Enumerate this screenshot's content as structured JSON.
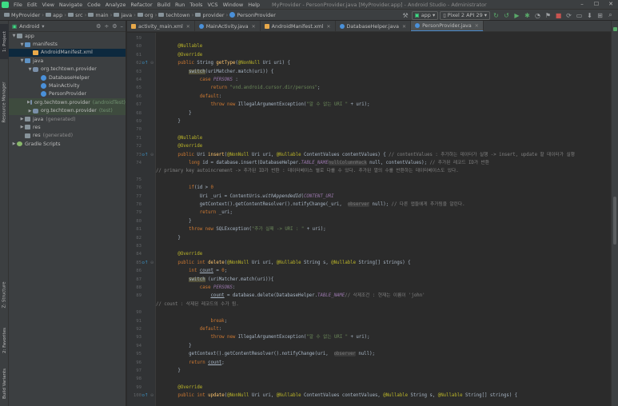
{
  "app": {
    "window_title": "MyProvider - PersonProvider.java [MyProvider.app] - Android Studio - Administrator"
  },
  "menu": [
    "File",
    "Edit",
    "View",
    "Navigate",
    "Code",
    "Analyze",
    "Refactor",
    "Build",
    "Run",
    "Tools",
    "VCS",
    "Window",
    "Help"
  ],
  "window_controls": [
    "–",
    "☐",
    "✕"
  ],
  "breadcrumb": [
    "MyProvider",
    "app",
    "src",
    "main",
    "java",
    "org",
    "techtown",
    "provider",
    "PersonProvider"
  ],
  "toolbar": {
    "run_config": "app",
    "device": "Pixel 2 API 29"
  },
  "left_tabs": [
    "1: Project",
    "Resource Manager",
    "Z: Structure",
    "2: Favorites",
    "Build Variants"
  ],
  "project": {
    "view_mode": "Android",
    "tree": [
      {
        "label": "app",
        "depth": 0,
        "icon": "folder",
        "expanded": true,
        "suffix": ""
      },
      {
        "label": "manifests",
        "depth": 1,
        "icon": "folder-blue",
        "expanded": true,
        "suffix": ""
      },
      {
        "label": "AndroidManifest.xml",
        "depth": 2,
        "icon": "xml",
        "expanded": null,
        "suffix": "",
        "selected": true
      },
      {
        "label": "java",
        "depth": 1,
        "icon": "folder-blue",
        "expanded": true,
        "suffix": ""
      },
      {
        "label": "org.techtown.provider",
        "depth": 2,
        "icon": "package",
        "expanded": true,
        "suffix": ""
      },
      {
        "label": "DatabaseHelper",
        "depth": 3,
        "icon": "class",
        "expanded": null,
        "suffix": ""
      },
      {
        "label": "MainActivity",
        "depth": 3,
        "icon": "class",
        "expanded": null,
        "suffix": ""
      },
      {
        "label": "PersonProvider",
        "depth": 3,
        "icon": "class",
        "expanded": null,
        "suffix": ""
      },
      {
        "label": "org.techtown.provider",
        "depth": 2,
        "icon": "package",
        "expanded": false,
        "suffix": "(androidTest)",
        "highlight": true
      },
      {
        "label": "org.techtown.provider",
        "depth": 2,
        "icon": "package",
        "expanded": false,
        "suffix": "(test)",
        "highlight": true
      },
      {
        "label": "java",
        "depth": 1,
        "icon": "folder",
        "expanded": false,
        "suffix": "(generated)",
        "grey": true
      },
      {
        "label": "res",
        "depth": 1,
        "icon": "folder",
        "expanded": false,
        "suffix": ""
      },
      {
        "label": "res",
        "depth": 1,
        "icon": "folder",
        "expanded": null,
        "suffix": "(generated)",
        "grey": true
      },
      {
        "label": "Gradle Scripts",
        "depth": 0,
        "icon": "gradle",
        "expanded": false,
        "suffix": ""
      }
    ]
  },
  "tabs": [
    {
      "label": "activity_main.xml",
      "icon": "xml",
      "active": false
    },
    {
      "label": "MainActivity.java",
      "icon": "class",
      "active": false
    },
    {
      "label": "AndroidManifest.xml",
      "icon": "xml",
      "active": false
    },
    {
      "label": "DatabaseHelper.java",
      "icon": "class",
      "active": false
    },
    {
      "label": "PersonProvider.java",
      "icon": "class",
      "active": true
    }
  ],
  "editor": {
    "lines": [
      {
        "n": "59",
        "segs": []
      },
      {
        "n": "60",
        "segs": [
          [
            "",
            "        "
          ],
          [
            "ann",
            "@Nullable"
          ]
        ]
      },
      {
        "n": "61",
        "segs": [
          [
            "",
            "        "
          ],
          [
            "ann",
            "@Override"
          ]
        ]
      },
      {
        "n": "62",
        "mark": "o↑",
        "fold": "⊖",
        "segs": [
          [
            "",
            "        "
          ],
          [
            "kw",
            "public "
          ],
          [
            "",
            "String "
          ],
          [
            "fn",
            "getType"
          ],
          [
            "",
            "("
          ],
          [
            "ann",
            "@NonNull "
          ],
          [
            "",
            "Uri uri) {"
          ]
        ]
      },
      {
        "n": "63",
        "segs": [
          [
            "",
            "            "
          ],
          [
            "hl",
            "switch"
          ],
          [
            "",
            "(uriMatcher.match(uri)) {"
          ]
        ]
      },
      {
        "n": "64",
        "segs": [
          [
            "",
            "                "
          ],
          [
            "kw",
            "case "
          ],
          [
            "const",
            "PERSONS"
          ],
          [
            "",
            " :"
          ]
        ]
      },
      {
        "n": "65",
        "segs": [
          [
            "",
            "                    "
          ],
          [
            "kw",
            "return "
          ],
          [
            "str",
            "\"vnd.android.cursor.dir/persons\""
          ],
          [
            "",
            ";"
          ]
        ]
      },
      {
        "n": "66",
        "segs": [
          [
            "",
            "                "
          ],
          [
            "kw",
            "default"
          ],
          [
            "",
            ":"
          ]
        ]
      },
      {
        "n": "67",
        "segs": [
          [
            "",
            "                    "
          ],
          [
            "kw",
            "throw new "
          ],
          [
            "",
            "IllegalArgumentException("
          ],
          [
            "str",
            "\"알 수 없는 URI \""
          ],
          [
            "",
            " + uri);"
          ]
        ]
      },
      {
        "n": "68",
        "segs": [
          [
            "",
            "            }"
          ]
        ]
      },
      {
        "n": "69",
        "segs": [
          [
            "",
            "        }"
          ]
        ]
      },
      {
        "n": "70",
        "segs": []
      },
      {
        "n": "71",
        "segs": [
          [
            "",
            "        "
          ],
          [
            "ann",
            "@Nullable"
          ]
        ]
      },
      {
        "n": "72",
        "segs": [
          [
            "",
            "        "
          ],
          [
            "ann",
            "@Override"
          ]
        ]
      },
      {
        "n": "73",
        "mark": "o↑",
        "fold": "⊖",
        "segs": [
          [
            "",
            "        "
          ],
          [
            "kw",
            "public "
          ],
          [
            "",
            "Uri "
          ],
          [
            "fn",
            "insert"
          ],
          [
            "",
            "("
          ],
          [
            "ann",
            "@NonNull "
          ],
          [
            "",
            "Uri uri, "
          ],
          [
            "ann",
            "@Nullable "
          ],
          [
            "",
            "ContentValues contentValues) { "
          ],
          [
            "cmt",
            "// contentValues : 추가하는 데이터가 실행 -> insert, update 할 데이터가 실행"
          ]
        ]
      },
      {
        "n": "74",
        "segs": [
          [
            "",
            "            "
          ],
          [
            "kw",
            "long "
          ],
          [
            "",
            "id = database.insert(DatabaseHelper."
          ],
          [
            "const",
            "TABLE_NAME"
          ],
          [
            ",  "
          ],
          [
            "hint",
            "nullColumnHack"
          ],
          [
            "",
            " null, contentValues); "
          ],
          [
            "cmt",
            "// 추가된 레코드 ID가 반환"
          ]
        ]
      },
      {
        "n": "",
        "segs": [
          [
            "cmt",
            "// primary key autoincrement -> 추가된 ID가 반환 : 데이터베이스 별로 다를 수 있다. 추가된 열의 수를 반환하는 데이터베이스도 있다."
          ]
        ]
      },
      {
        "n": "75",
        "segs": []
      },
      {
        "n": "76",
        "segs": [
          [
            "",
            "            "
          ],
          [
            "kw",
            "if"
          ],
          [
            "",
            "(id > "
          ],
          [
            "kw",
            "0"
          ],
          [
            ") {"
          ]
        ]
      },
      {
        "n": "77",
        "segs": [
          [
            "",
            "                Uri _uri = ContentUris."
          ],
          [
            "ital",
            "withAppendedId"
          ],
          [
            "",
            "("
          ],
          [
            "const",
            "CONTENT_URI"
          ],
          [
            ", id);"
          ]
        ]
      },
      {
        "n": "78",
        "segs": [
          [
            "",
            "                getContext().getContentResolver().notifyChange(_uri,  "
          ],
          [
            "hint",
            "observer"
          ],
          [
            "",
            " null); "
          ],
          [
            "cmt",
            "// 다른 앱들에게 추가됨을 알린다."
          ]
        ]
      },
      {
        "n": "79",
        "segs": [
          [
            "",
            "                "
          ],
          [
            "kw",
            "return "
          ],
          [
            "",
            "_uri;"
          ]
        ]
      },
      {
        "n": "80",
        "segs": [
          [
            "",
            "            }"
          ]
        ]
      },
      {
        "n": "81",
        "segs": [
          [
            "",
            "            "
          ],
          [
            "kw",
            "throw new "
          ],
          [
            "",
            "SQLException("
          ],
          [
            "str",
            "\"추가 실패 -> URI : \""
          ],
          [
            "",
            " + uri);"
          ]
        ]
      },
      {
        "n": "82",
        "segs": [
          [
            "",
            "        }"
          ]
        ]
      },
      {
        "n": "83",
        "segs": []
      },
      {
        "n": "84",
        "segs": [
          [
            "",
            "        "
          ],
          [
            "ann",
            "@Override"
          ]
        ]
      },
      {
        "n": "85",
        "mark": "o↑",
        "fold": "⊖",
        "segs": [
          [
            "",
            "        "
          ],
          [
            "kw",
            "public int "
          ],
          [
            "fn",
            "delete"
          ],
          [
            "",
            "("
          ],
          [
            "ann",
            "@NonNull "
          ],
          [
            "",
            "Uri uri, "
          ],
          [
            "ann",
            "@Nullable "
          ],
          [
            "",
            "String s, "
          ],
          [
            "ann",
            "@Nullable "
          ],
          [
            "",
            "String[] strings) {"
          ]
        ]
      },
      {
        "n": "86",
        "segs": [
          [
            "",
            "            "
          ],
          [
            "kw",
            "int "
          ],
          [
            "u",
            "count"
          ],
          [
            "",
            " = "
          ],
          [
            "kw",
            "0"
          ],
          [
            "",
            ";"
          ]
        ]
      },
      {
        "n": "87",
        "segs": [
          [
            "",
            "            "
          ],
          [
            "hl",
            "switch"
          ],
          [
            "",
            " (uriMatcher.match(uri)){"
          ]
        ]
      },
      {
        "n": "88",
        "segs": [
          [
            "",
            "                "
          ],
          [
            "kw",
            "case "
          ],
          [
            "const",
            "PERSONS"
          ],
          [
            "",
            ":"
          ]
        ]
      },
      {
        "n": "89",
        "segs": [
          [
            "",
            "                    "
          ],
          [
            "u",
            "count"
          ],
          [
            "",
            " = database.delete(DatabaseHelper."
          ],
          [
            "const",
            "TABLE_NAME"
          ],
          [
            ", s, strings); "
          ],
          [
            "cmt",
            "// 삭제조건 : 현재는 이름이 'john'"
          ]
        ]
      },
      {
        "n": "",
        "segs": [
          [
            "cmt",
            "// count : 삭제된 레코드의 수가 됨."
          ]
        ]
      },
      {
        "n": "90",
        "segs": []
      },
      {
        "n": "91",
        "segs": [
          [
            "",
            "                    "
          ],
          [
            "kw",
            "break"
          ],
          [
            "",
            ";"
          ]
        ]
      },
      {
        "n": "92",
        "segs": [
          [
            "",
            "                "
          ],
          [
            "kw",
            "default"
          ],
          [
            "",
            ":"
          ]
        ]
      },
      {
        "n": "93",
        "segs": [
          [
            "",
            "                    "
          ],
          [
            "kw",
            "throw new "
          ],
          [
            "",
            "IllegalArgumentException("
          ],
          [
            "str",
            "\"알 수 없는 URI \""
          ],
          [
            "",
            " + uri);"
          ]
        ]
      },
      {
        "n": "94",
        "segs": [
          [
            "",
            "            }"
          ]
        ]
      },
      {
        "n": "95",
        "segs": [
          [
            "",
            "            getContext().getContentResolver().notifyChange(uri,  "
          ],
          [
            "hint",
            "observer"
          ],
          [
            "",
            " null);"
          ]
        ]
      },
      {
        "n": "96",
        "segs": [
          [
            "",
            "            "
          ],
          [
            "kw",
            "return "
          ],
          [
            "u",
            "count"
          ],
          [
            "",
            ";"
          ]
        ]
      },
      {
        "n": "97",
        "segs": [
          [
            "",
            "        }"
          ]
        ]
      },
      {
        "n": "98",
        "segs": []
      },
      {
        "n": "99",
        "segs": [
          [
            "",
            "        "
          ],
          [
            "ann",
            "@Override"
          ]
        ]
      },
      {
        "n": "100",
        "mark": "o↑",
        "fold": "⊖",
        "segs": [
          [
            "",
            "        "
          ],
          [
            "kw",
            "public int "
          ],
          [
            "fn",
            "update"
          ],
          [
            "",
            "("
          ],
          [
            "ann",
            "@NonNull "
          ],
          [
            "",
            "Uri uri, "
          ],
          [
            "ann",
            "@Nullable "
          ],
          [
            "",
            "ContentValues contentValues, "
          ],
          [
            "ann",
            "@Nullable "
          ],
          [
            "",
            "String s, "
          ],
          [
            "ann",
            "@Nullable "
          ],
          [
            "",
            "String[] strings) {"
          ]
        ]
      }
    ]
  },
  "colors": {
    "accent": "#4a88c7",
    "keyword": "#cc7832",
    "annotation": "#bbb529",
    "string": "#6a8759",
    "comment": "#808080",
    "constant": "#9876aa",
    "function": "#ffc66d",
    "background": "#2b2b2b"
  }
}
